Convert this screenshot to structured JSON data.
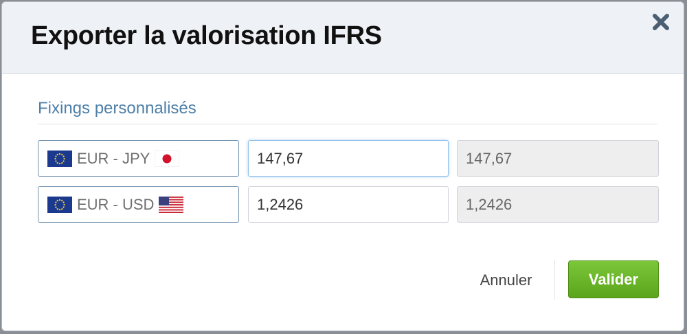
{
  "dialog": {
    "title": "Exporter la valorisation IFRS",
    "close_icon": "close-icon"
  },
  "section": {
    "title": "Fixings personnalisés"
  },
  "rows": [
    {
      "pair": "EUR - JPY",
      "base_flag": "eu-flag-icon",
      "quote_flag": "japan-flag-icon",
      "custom_value": "147,67",
      "reference_value": "147,67"
    },
    {
      "pair": "EUR - USD",
      "base_flag": "eu-flag-icon",
      "quote_flag": "us-flag-icon",
      "custom_value": "1,2426",
      "reference_value": "1,2426"
    }
  ],
  "actions": {
    "cancel_label": "Annuler",
    "validate_label": "Valider"
  },
  "colors": {
    "section_title": "#4e7fa8",
    "validate_button": "#6bb52a",
    "header_background": "#eef1f5"
  }
}
